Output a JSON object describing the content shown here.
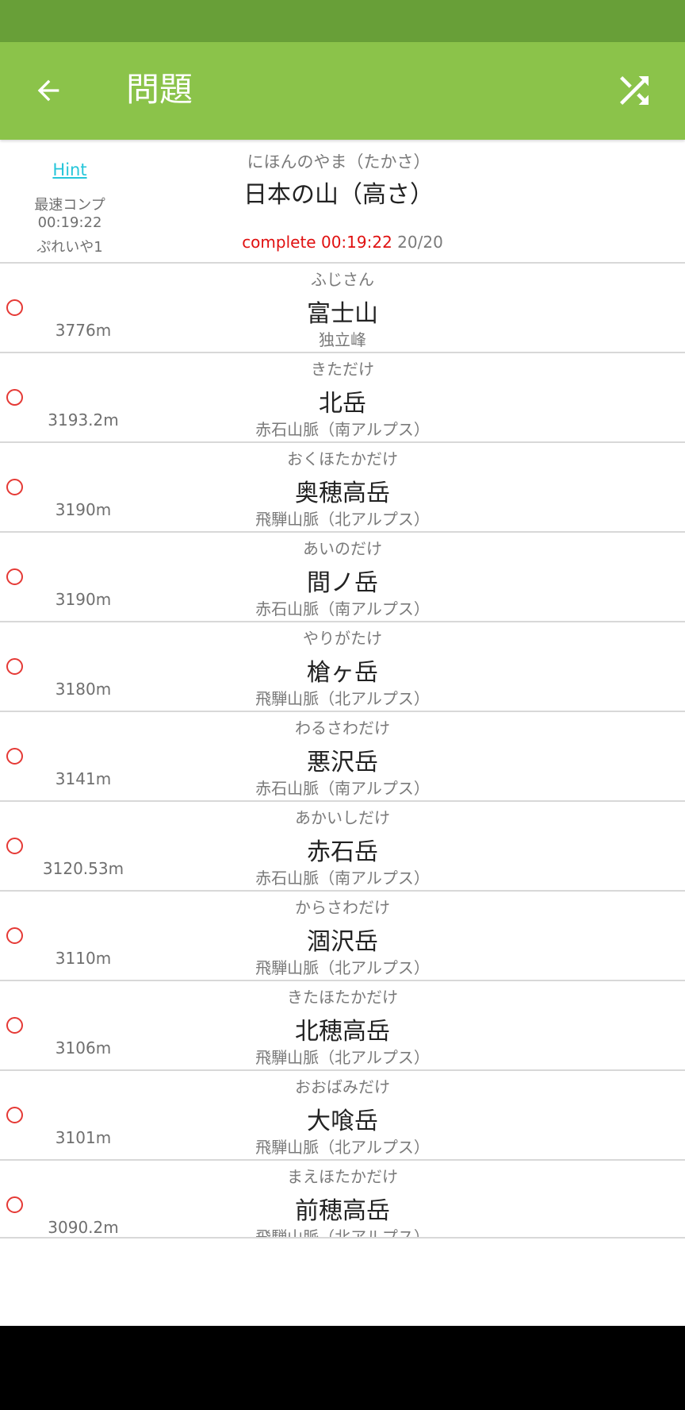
{
  "app_bar": {
    "title": "問題"
  },
  "colors": {
    "status_bar": "#689f38",
    "app_bar": "#8bc34a",
    "hint_link": "#26c6da",
    "complete": "#e01010",
    "correct_mark": "#e53935"
  },
  "icons": {
    "back": "arrow-left-icon",
    "shuffle": "shuffle-icon",
    "correct": "circle-mark-icon"
  },
  "header": {
    "hint": "Hint",
    "best_label": "最速コンプ",
    "best_time": "00:19:22",
    "best_player": "ぷれいや1",
    "quiz_reading": "にほんのやま（たかさ）",
    "quiz_title": "日本の山（高さ）",
    "complete_text": "complete 00:19:22",
    "count_text": "20/20"
  },
  "items": [
    {
      "reading": "ふじさん",
      "name": "富士山",
      "range": "独立峰",
      "height": "3776m"
    },
    {
      "reading": "きただけ",
      "name": "北岳",
      "range": "赤石山脈（南アルプス）",
      "height": "3193.2m"
    },
    {
      "reading": "おくほたかだけ",
      "name": "奥穂高岳",
      "range": "飛騨山脈（北アルプス）",
      "height": "3190m"
    },
    {
      "reading": "あいのだけ",
      "name": "間ノ岳",
      "range": "赤石山脈（南アルプス）",
      "height": "3190m"
    },
    {
      "reading": "やりがたけ",
      "name": "槍ヶ岳",
      "range": "飛騨山脈（北アルプス）",
      "height": "3180m"
    },
    {
      "reading": "わるさわだけ",
      "name": "悪沢岳",
      "range": "赤石山脈（南アルプス）",
      "height": "3141m"
    },
    {
      "reading": "あかいしだけ",
      "name": "赤石岳",
      "range": "赤石山脈（南アルプス）",
      "height": "3120.53m"
    },
    {
      "reading": "からさわだけ",
      "name": "涸沢岳",
      "range": "飛騨山脈（北アルプス）",
      "height": "3110m"
    },
    {
      "reading": "きたほたかだけ",
      "name": "北穂高岳",
      "range": "飛騨山脈（北アルプス）",
      "height": "3106m"
    },
    {
      "reading": "おおばみだけ",
      "name": "大喰岳",
      "range": "飛騨山脈（北アルプス）",
      "height": "3101m"
    },
    {
      "reading": "まえほたかだけ",
      "name": "前穂高岳",
      "range": "飛騨山脈（北アルプス）",
      "height": "3090.2m"
    }
  ]
}
